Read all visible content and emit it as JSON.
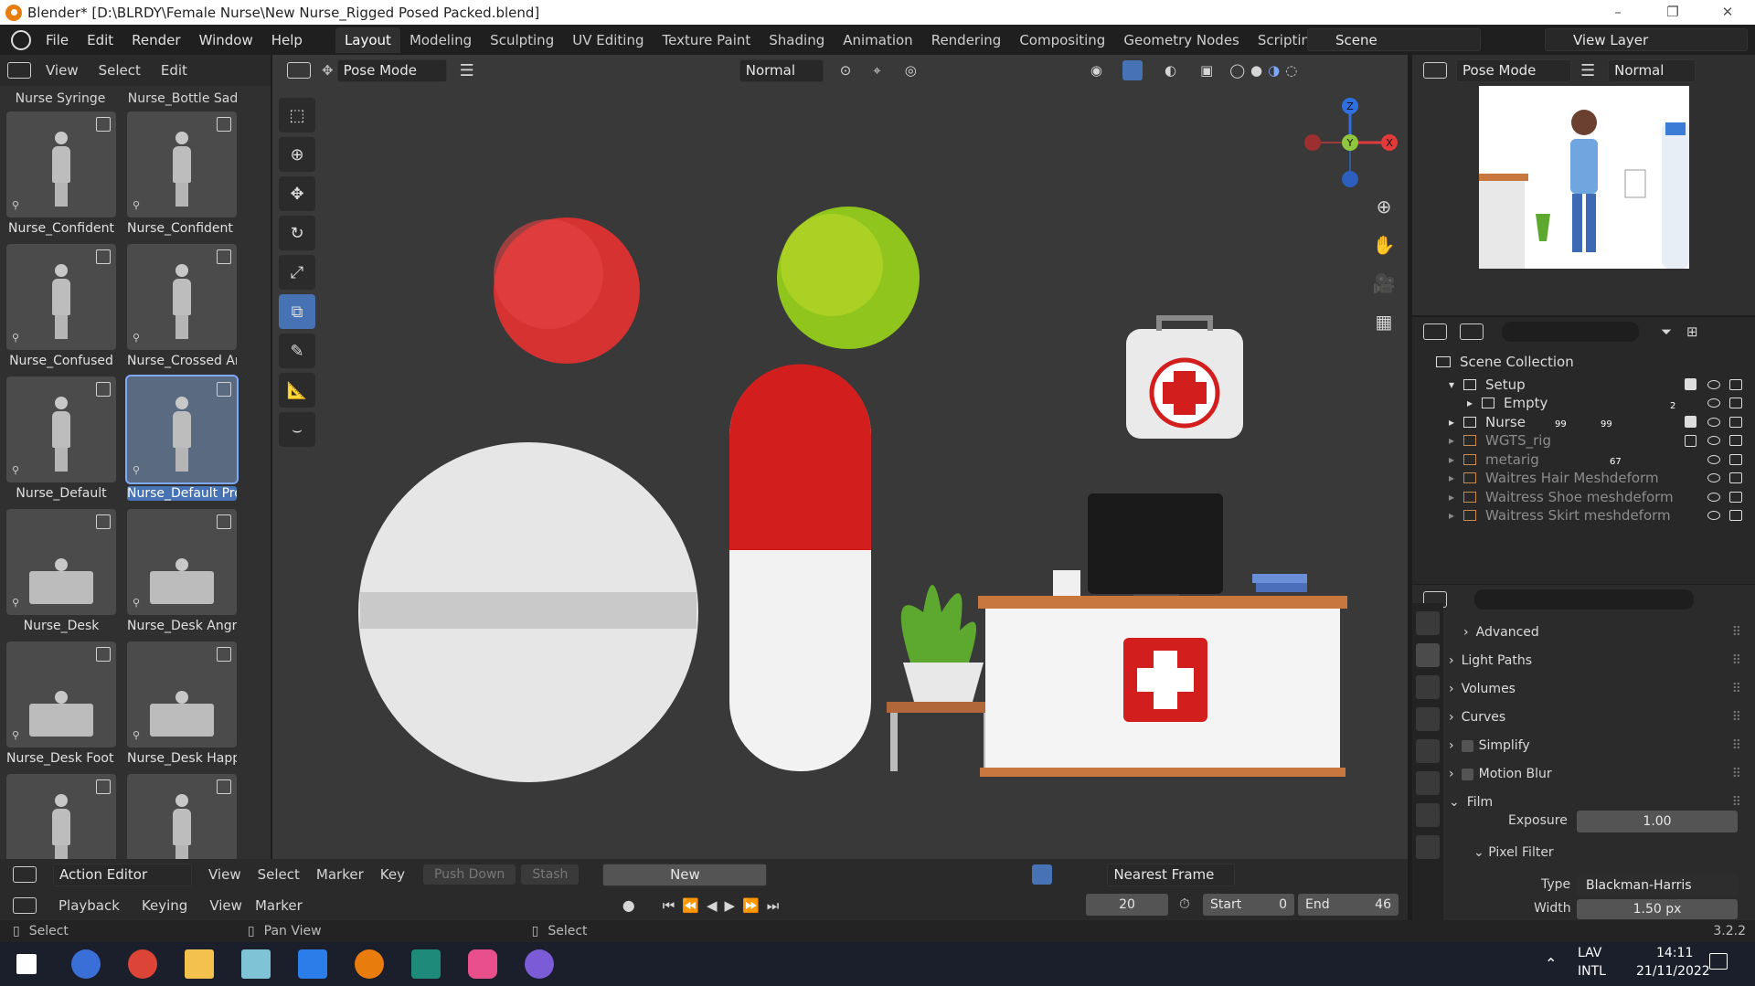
{
  "window": {
    "title": "Blender* [D:\\BLRDY\\Female Nurse\\New Nurse_Rigged Posed Packed.blend]",
    "controls": [
      "–",
      "❐",
      "✕"
    ]
  },
  "menus": [
    "File",
    "Edit",
    "Render",
    "Window",
    "Help"
  ],
  "workspaces": [
    "Layout",
    "Modeling",
    "Sculpting",
    "UV Editing",
    "Texture Paint",
    "Shading",
    "Animation",
    "Rendering",
    "Compositing",
    "Geometry Nodes",
    "Scripting"
  ],
  "add_workspace": "+",
  "scene": {
    "label": "Scene",
    "view_layer": "View Layer"
  },
  "asset_browser": {
    "menus": [
      "View",
      "Select",
      "Edit"
    ],
    "top_labels": [
      "Nurse Syringe",
      "Nurse_Bottle Sad"
    ],
    "items": [
      {
        "label": "Nurse_Confident",
        "kind": "fig"
      },
      {
        "label": "Nurse_Confident ...",
        "kind": "fig"
      },
      {
        "label": "Nurse_Confused",
        "kind": "fig"
      },
      {
        "label": "Nurse_Crossed Arm",
        "kind": "fig"
      },
      {
        "label": "Nurse_Default",
        "kind": "fig"
      },
      {
        "label": "Nurse_Default Pro...",
        "kind": "fig",
        "selected": true
      },
      {
        "label": "Nurse_Desk",
        "kind": "desk"
      },
      {
        "label": "Nurse_Desk Angry",
        "kind": "desk"
      },
      {
        "label": "Nurse_Desk Foot ...",
        "kind": "desk"
      },
      {
        "label": "Nurse_Desk Happy",
        "kind": "desk"
      },
      {
        "label": "",
        "kind": "fig"
      },
      {
        "label": "",
        "kind": "fig"
      }
    ]
  },
  "viewport": {
    "mode": "Pose Mode",
    "orientation": "Normal",
    "gizmo_axes": {
      "z": "Z",
      "y": "Y",
      "x": "X"
    }
  },
  "camera_view": {
    "mode": "Pose Mode",
    "orientation": "Normal"
  },
  "outliner": {
    "root": "Scene Collection",
    "rows": [
      {
        "label": "Setup",
        "indent": 1,
        "dim": false,
        "checked": true
      },
      {
        "label": "Empty",
        "indent": 2,
        "dim": false,
        "checked": null
      },
      {
        "label": "Nurse",
        "indent": 1,
        "dim": false,
        "checked": true
      },
      {
        "label": "WGTS_rig",
        "indent": 1,
        "dim": true,
        "checked": false
      },
      {
        "label": "metarig",
        "indent": 1,
        "dim": true,
        "checked": null
      },
      {
        "label": "Waitres Hair Meshdeform",
        "indent": 1,
        "dim": true,
        "checked": null
      },
      {
        "label": "Waitress Shoe meshdeform",
        "indent": 1,
        "dim": true,
        "checked": null
      },
      {
        "label": "Waitress Skirt meshdeform",
        "indent": 1,
        "dim": true,
        "checked": null
      }
    ],
    "badges": {
      "empty": "2",
      "nurse_a": "99",
      "nurse_b": "99",
      "metarig": "67"
    }
  },
  "properties": {
    "sections": [
      "Advanced",
      "Light Paths",
      "Volumes",
      "Curves",
      "Simplify",
      "Motion Blur",
      "Film"
    ],
    "exposure_label": "Exposure",
    "exposure_value": "1.00",
    "pixel_filter": "Pixel Filter",
    "type_label": "Type",
    "type_value": "Blackman-Harris",
    "width_label": "Width",
    "width_value": "1.50 px"
  },
  "action_editor": {
    "mode": "Action Editor",
    "menus": [
      "View",
      "Select",
      "Marker",
      "Key"
    ],
    "push_down": "Push Down",
    "stash": "Stash",
    "new": "New",
    "snap": "Nearest Frame"
  },
  "timeline": {
    "menus": [
      "Playback",
      "Keying",
      "View",
      "Marker"
    ],
    "current_frame": "20",
    "start_label": "Start",
    "start": "0",
    "end_label": "End",
    "end": "46"
  },
  "status": {
    "select": "Select",
    "pan": "Pan View",
    "select2": "Select",
    "version": "3.2.2"
  },
  "taskbar": {
    "lang": "LAV",
    "lang2": "INTL",
    "time": "14:11",
    "date": "21/11/2022"
  }
}
